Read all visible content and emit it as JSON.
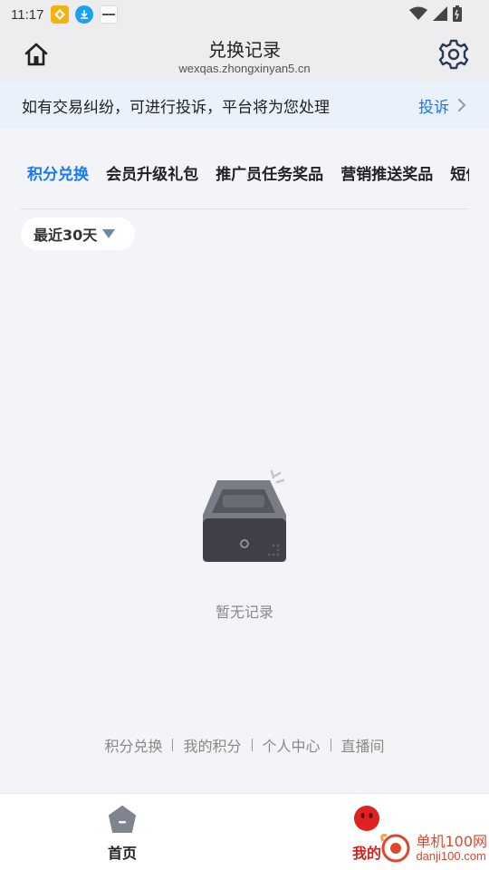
{
  "status_bar": {
    "time": "11:17",
    "app_icons": [
      "app-logo-icon",
      "download-icon",
      "news-icon"
    ],
    "system_icons": [
      "wifi-icon",
      "signal-icon",
      "battery-icon"
    ]
  },
  "header": {
    "title": "兑换记录",
    "subtitle": "wexqas.zhongxinyan5.cn"
  },
  "notice": {
    "text": "如有交易纠纷，可进行投诉，平台将为您处理",
    "link": "投诉"
  },
  "tabs": [
    {
      "label": "积分兑换",
      "active": true
    },
    {
      "label": "会员升级礼包",
      "active": false
    },
    {
      "label": "推广员任务奖品",
      "active": false
    },
    {
      "label": "营销推送奖品",
      "active": false
    },
    {
      "label": "短信",
      "active": false
    }
  ],
  "filter": {
    "label": "最近30天"
  },
  "empty_state": {
    "text": "暂无记录"
  },
  "footer_links": [
    "积分兑换",
    "我的积分",
    "个人中心",
    "直播间"
  ],
  "bottom_nav": {
    "home_label": "首页",
    "mine_label": "我的"
  },
  "watermark": {
    "main": "单机100网",
    "sub": "danji100.com"
  },
  "colors": {
    "accent": "#1677ff",
    "notice_bg": "#e9f1fb",
    "page_bg": "#f3f4f8",
    "brand_red": "#d81e1e"
  }
}
